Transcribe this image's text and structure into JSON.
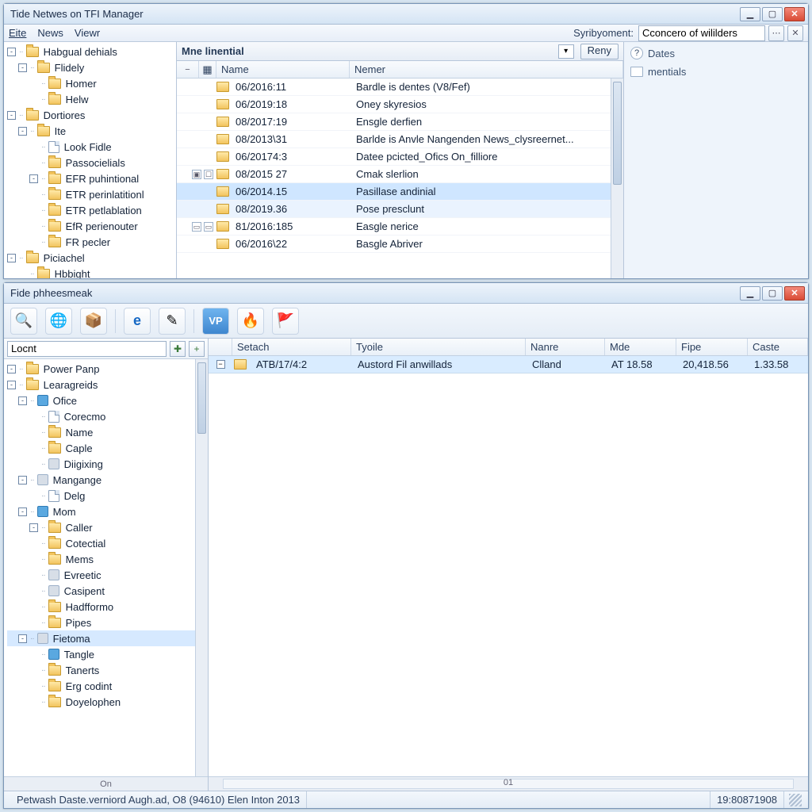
{
  "top": {
    "title": "Tide Netwes on TFI Manager",
    "menus": {
      "eite": "Eite",
      "news": "News",
      "viewr": "Viewr"
    },
    "toolbar": {
      "search_label": "Syribyoment:",
      "search_value": "Cconcero of wililders"
    },
    "tree": [
      {
        "lvl": 0,
        "exp": "-",
        "icon": "folder",
        "label": "Habgual dehials"
      },
      {
        "lvl": 1,
        "exp": "-",
        "icon": "folder",
        "label": "Flidely"
      },
      {
        "lvl": 2,
        "exp": "",
        "icon": "folder",
        "label": "Homer"
      },
      {
        "lvl": 2,
        "exp": "",
        "icon": "folder",
        "label": "Helw"
      },
      {
        "lvl": 0,
        "exp": "-",
        "icon": "folder",
        "label": "Dortiores"
      },
      {
        "lvl": 1,
        "exp": "-",
        "icon": "folder",
        "label": "Ite"
      },
      {
        "lvl": 2,
        "exp": "",
        "icon": "doc",
        "label": "Look Fidle"
      },
      {
        "lvl": 2,
        "exp": "",
        "icon": "folder",
        "label": "Passocielials"
      },
      {
        "lvl": 2,
        "exp": "-",
        "icon": "folder",
        "label": "EFR puhintional"
      },
      {
        "lvl": 2,
        "exp": "",
        "icon": "folder",
        "label": "ETR perinlatitionl"
      },
      {
        "lvl": 2,
        "exp": "",
        "icon": "folder",
        "label": "ETR petlablation"
      },
      {
        "lvl": 2,
        "exp": "",
        "icon": "folder",
        "label": "EfR perienouter"
      },
      {
        "lvl": 2,
        "exp": "",
        "icon": "folder",
        "label": "FR pecler"
      },
      {
        "lvl": 0,
        "exp": "-",
        "icon": "folder",
        "label": "Piciachel"
      },
      {
        "lvl": 1,
        "exp": "",
        "icon": "folder",
        "label": "Hbbight"
      }
    ],
    "list": {
      "header_title": "Mne linential",
      "reny": "Reny",
      "col_name": "Name",
      "col_nemer": "Nemer",
      "rows": [
        {
          "g": [],
          "name": "06/2016:11",
          "desc": "Bardle is dentes (V8/Fef)",
          "sel": false
        },
        {
          "g": [],
          "name": "06/2019:18",
          "desc": "Oney skyresios",
          "sel": false
        },
        {
          "g": [],
          "name": "08/2017:19",
          "desc": "Ensgle derfien",
          "sel": false
        },
        {
          "g": [],
          "name": "08/2013\\31",
          "desc": "Barlde is Anvle Nangenden News_clysreernet...",
          "sel": false
        },
        {
          "g": [],
          "name": "06/20174:3",
          "desc": "Datee pcicted_Ofics On_filliore",
          "sel": false
        },
        {
          "g": [
            "▣",
            "☐"
          ],
          "name": "08/2015 27",
          "desc": "Cmak slerlion",
          "sel": false
        },
        {
          "g": [],
          "name": "06/2014.15",
          "desc": "Pasillase andinial",
          "sel": true
        },
        {
          "g": [],
          "name": "08/2019.36",
          "desc": "Pose presclunt",
          "sel": false,
          "hov": true
        },
        {
          "g": [
            "▭",
            "▭"
          ],
          "name": "81/2016:185",
          "desc": "Easgle nerice",
          "sel": false
        },
        {
          "g": [],
          "name": "06/2016\\22",
          "desc": "Basgle Abriver",
          "sel": false
        }
      ]
    },
    "side": {
      "dates": "Dates",
      "mentials": "mentials"
    }
  },
  "bot": {
    "title": "Fide phheesmeak",
    "search_value": "Locnt",
    "tree": [
      {
        "lvl": 0,
        "exp": "-",
        "icon": "folder",
        "label": "Power Panp"
      },
      {
        "lvl": 0,
        "exp": "-",
        "icon": "folder",
        "label": "Learagreids"
      },
      {
        "lvl": 1,
        "exp": "-",
        "icon": "blue",
        "label": "Ofice"
      },
      {
        "lvl": 2,
        "exp": "",
        "icon": "doc",
        "label": "Corecmo"
      },
      {
        "lvl": 2,
        "exp": "",
        "icon": "folder",
        "label": "Name"
      },
      {
        "lvl": 2,
        "exp": "",
        "icon": "folder",
        "label": "Caple"
      },
      {
        "lvl": 2,
        "exp": "",
        "icon": "grey",
        "label": "Diigixing"
      },
      {
        "lvl": 1,
        "exp": "-",
        "icon": "grey",
        "label": "Mangange"
      },
      {
        "lvl": 2,
        "exp": "",
        "icon": "doc",
        "label": "Delg"
      },
      {
        "lvl": 1,
        "exp": "-",
        "icon": "blue",
        "label": "Mom"
      },
      {
        "lvl": 2,
        "exp": "-",
        "icon": "folder",
        "label": "Caller"
      },
      {
        "lvl": 2,
        "exp": "",
        "icon": "folder",
        "label": "Cotectial"
      },
      {
        "lvl": 2,
        "exp": "",
        "icon": "folder",
        "label": "Mems"
      },
      {
        "lvl": 2,
        "exp": "",
        "icon": "grey",
        "label": "Evreetic"
      },
      {
        "lvl": 2,
        "exp": "",
        "icon": "grey",
        "label": "Casipent"
      },
      {
        "lvl": 2,
        "exp": "",
        "icon": "folder",
        "label": "Hadfformo"
      },
      {
        "lvl": 2,
        "exp": "",
        "icon": "folder",
        "label": "Pipes"
      },
      {
        "lvl": 1,
        "exp": "-",
        "icon": "grey",
        "label": "Fietoma",
        "sel": true
      },
      {
        "lvl": 2,
        "exp": "",
        "icon": "blue",
        "label": "Tangle"
      },
      {
        "lvl": 2,
        "exp": "",
        "icon": "folder",
        "label": "Tanerts"
      },
      {
        "lvl": 2,
        "exp": "",
        "icon": "folder",
        "label": "Erg codint"
      },
      {
        "lvl": 2,
        "exp": "",
        "icon": "folder",
        "label": "Doyelophen"
      }
    ],
    "hscroll_label": "On",
    "cols": {
      "setach": "Setach",
      "tyoile": "Tyoile",
      "nanre": "Nanre",
      "mde": "Mde",
      "fipe": "Fipe",
      "caste": "Caste"
    },
    "row": {
      "setach": "ATB/17/4:2",
      "tyoile": "Austord Fil anwillads",
      "nanre": "Clland",
      "mde": "AT 18.58",
      "fipe": "20,418.56",
      "caste": "1.33.58"
    },
    "right_hscroll_label": "01",
    "status_left": "Petwash Daste.verniord Augh.ad, O8 (94610) Elen Inton 2013",
    "status_right": "19:80871908"
  }
}
